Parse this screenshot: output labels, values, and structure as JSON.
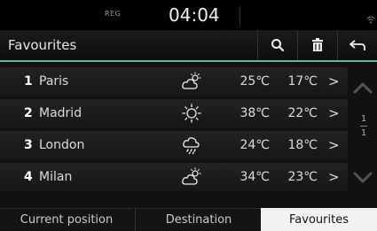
{
  "status": {
    "reg": "REG",
    "time": "04:04"
  },
  "header": {
    "title": "Favourites"
  },
  "icons": {
    "search": "search-icon",
    "delete": "trash-icon",
    "back": "back-arrow-icon",
    "wifi": "wifi-icon"
  },
  "colors": {
    "accent": "#5fb8a5",
    "active_tab_bg": "#f2f2f2"
  },
  "list": [
    {
      "num": "1",
      "city": "Paris",
      "weather": "partly-cloudy-icon",
      "high": "25℃",
      "low": "17℃",
      "chevron": ">"
    },
    {
      "num": "2",
      "city": "Madrid",
      "weather": "sunny-icon",
      "high": "38℃",
      "low": "22℃",
      "chevron": ">"
    },
    {
      "num": "3",
      "city": "London",
      "weather": "rain-icon",
      "high": "24℃",
      "low": "18℃",
      "chevron": ">"
    },
    {
      "num": "4",
      "city": "Milan",
      "weather": "partly-cloudy-icon",
      "high": "34℃",
      "low": "23℃",
      "chevron": ">"
    }
  ],
  "pagination": {
    "current": "1",
    "total": "1"
  },
  "tabs": [
    {
      "label": "Current position",
      "active": false
    },
    {
      "label": "Destination",
      "active": false
    },
    {
      "label": "Favourites",
      "active": true
    }
  ]
}
